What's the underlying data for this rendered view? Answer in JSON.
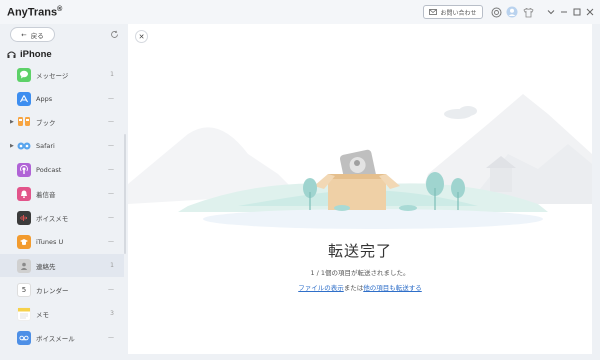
{
  "app": {
    "title": "AnyTrans",
    "reg": "®"
  },
  "titlebar": {
    "contact_label": "お問い合わせ"
  },
  "sidebar": {
    "back_label": "戻る",
    "device_name": "iPhone",
    "items": [
      {
        "label": "メッセージ",
        "count": "1",
        "icon": "messages-icon",
        "color": "#5dd168",
        "active": false,
        "arrow": false
      },
      {
        "label": "Apps",
        "count": "—",
        "icon": "appstore-icon",
        "color": "#3d8ef0",
        "active": false,
        "arrow": false
      },
      {
        "label": "ブック",
        "count": "—",
        "icon": "books-icon",
        "color": "#f7a542",
        "active": false,
        "arrow": true
      },
      {
        "label": "Safari",
        "count": "—",
        "icon": "safari-icon",
        "color": "#5aa6ee",
        "active": false,
        "arrow": true
      },
      {
        "label": "Podcast",
        "count": "—",
        "icon": "podcast-icon",
        "color": "#b063d6",
        "active": false,
        "arrow": false
      },
      {
        "label": "着信音",
        "count": "—",
        "icon": "ringtone-icon",
        "color": "#e2548a",
        "active": false,
        "arrow": false
      },
      {
        "label": "ボイスメモ",
        "count": "—",
        "icon": "voicememo-icon",
        "color": "#3b3b3b",
        "active": false,
        "arrow": false
      },
      {
        "label": "iTunes U",
        "count": "—",
        "icon": "itunesu-icon",
        "color": "#f29b2e",
        "active": false,
        "arrow": false
      },
      {
        "label": "連絡先",
        "count": "1",
        "icon": "contacts-icon",
        "color": "#c9c9c9",
        "active": true,
        "arrow": false
      },
      {
        "label": "カレンダー",
        "count": "—",
        "icon": "calendar-icon",
        "color": "#ffffff",
        "active": false,
        "arrow": false
      },
      {
        "label": "メモ",
        "count": "3",
        "icon": "notes-icon",
        "color": "#f6d14a",
        "active": false,
        "arrow": false
      },
      {
        "label": "ボイスメール",
        "count": "—",
        "icon": "voicemail-icon",
        "color": "#4d8fe6",
        "active": false,
        "arrow": false
      }
    ],
    "calendar_day": "5"
  },
  "main": {
    "title": "転送完了",
    "subtitle": "1 / 1個の項目が転送されました。",
    "link_show": "ファイルの表示",
    "link_or": "または",
    "link_transfer_more": "他の項目も転送する"
  }
}
